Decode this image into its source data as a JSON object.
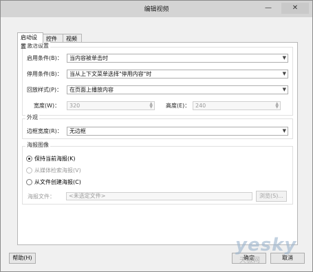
{
  "window": {
    "title": "编辑视频",
    "minimize_icon": "minimize-icon",
    "close_icon": "close-icon"
  },
  "tabs": [
    {
      "label": "启动设置",
      "active": true
    },
    {
      "label": "控件",
      "active": false
    },
    {
      "label": "视频",
      "active": false
    }
  ],
  "activation": {
    "title": "激活设置",
    "enable_label": "启用条件(B)：",
    "enable_value": "当内容被单击时",
    "disable_label": "停用条件(B)：",
    "disable_value": "当从上下文菜单选择\"停用内容\"时",
    "playback_label": "回放样式(P)：",
    "playback_value": "在页面上播放内容",
    "width_label": "宽度(W)：",
    "width_value": "320",
    "height_label": "高度(E)：",
    "height_value": "240"
  },
  "appearance": {
    "title": "外观",
    "border_label": "边框宽度(R)：",
    "border_value": "无边框"
  },
  "poster": {
    "title": "海报图像",
    "options": [
      {
        "label": "保持当前海报(K)",
        "selected": true,
        "enabled": true
      },
      {
        "label": "从媒体检索海报(V)",
        "selected": false,
        "enabled": false
      },
      {
        "label": "从文件创建海报(C)",
        "selected": false,
        "enabled": true
      }
    ],
    "file_label": "海报文件：",
    "file_placeholder": "<未选定文件>",
    "browse_label": "浏览(S)..."
  },
  "footer": {
    "help_label": "帮助(H)",
    "ok_label": "确定",
    "cancel_label": "取消"
  },
  "watermark": {
    "text": "yesky",
    "sub": "天极网"
  }
}
